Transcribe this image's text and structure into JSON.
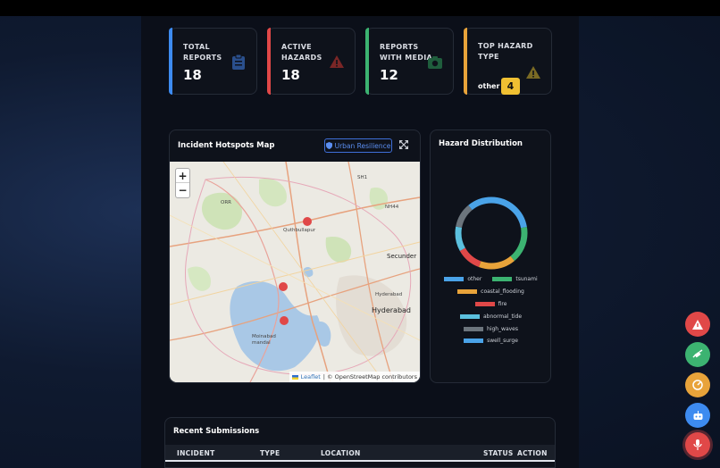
{
  "stats": [
    {
      "label": "TOTAL REPORTS",
      "value": "18",
      "accent": "#3d8bf0",
      "icon": "clipboard-icon"
    },
    {
      "label": "ACTIVE HAZARDS",
      "value": "18",
      "accent": "#e04848",
      "icon": "warning-icon"
    },
    {
      "label": "REPORTS WITH MEDIA",
      "value": "12",
      "accent": "#3cb371",
      "icon": "camera-icon"
    },
    {
      "label": "TOP HAZARD TYPE",
      "value": "other",
      "badge": "4",
      "accent": "#e8a33a",
      "icon": "warning-icon"
    }
  ],
  "map_panel": {
    "title": "Incident Hotspots Map",
    "urban_button": "Urban Resilience",
    "zoom_in": "+",
    "zoom_out": "−",
    "attribution_leaflet": "Leaflet",
    "attribution_rest": "| © OpenStreetMap contributors",
    "labels": {
      "orr": "ORR",
      "sh1": "SH1",
      "nh44": "NH44",
      "quthbullapur": "Quthbullapur",
      "secunder": "Secunder",
      "hyderabad_small": "Hyderabad",
      "hyderabad": "Hyderabad",
      "moinabad": "Moinabad mandal"
    }
  },
  "hazard_panel": {
    "title": "Hazard Distribution"
  },
  "chart_data": {
    "type": "pie",
    "title": "Hazard Distribution",
    "categories": [
      "other",
      "tsunami",
      "coastal_flooding",
      "fire",
      "abnormal_tide",
      "high_waves",
      "swell_surge"
    ],
    "values": [
      4,
      3,
      3,
      2,
      2,
      2,
      2
    ],
    "colors": [
      "#4aa3e8",
      "#3cb371",
      "#e8a33a",
      "#e04848",
      "#5bc0de",
      "#6c757d",
      "#4aa3e8"
    ],
    "legend_position": "bottom"
  },
  "recent": {
    "title": "Recent Submissions",
    "columns": [
      "INCIDENT",
      "TYPE",
      "LOCATION",
      "STATUS",
      "ACTION"
    ]
  },
  "fabs": [
    {
      "name": "report-hazard-fab",
      "icon": "warning-icon",
      "color": "#e04848"
    },
    {
      "name": "social-feed-fab",
      "icon": "satellite-icon",
      "color": "#3cb371"
    },
    {
      "name": "analytics-fab",
      "icon": "speedometer-icon",
      "color": "#e8a33a"
    },
    {
      "name": "chatbot-fab",
      "icon": "robot-icon",
      "color": "#3d8bf0"
    },
    {
      "name": "voice-report-fab",
      "icon": "microphone-icon",
      "color": "#e04848"
    }
  ]
}
